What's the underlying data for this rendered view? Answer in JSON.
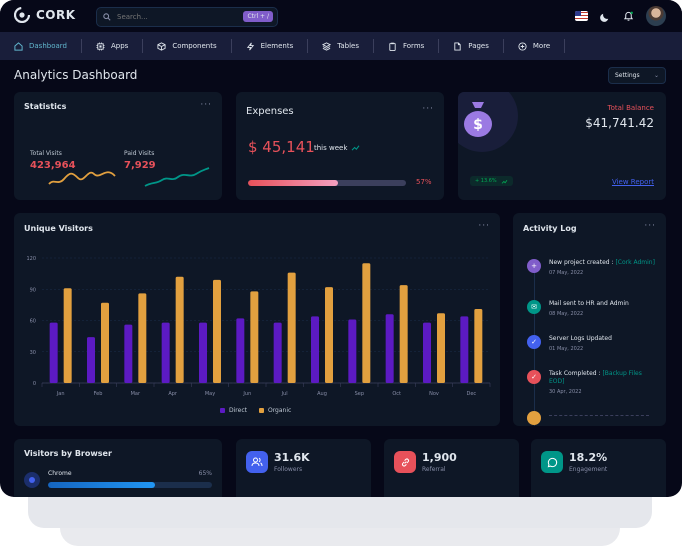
{
  "app": {
    "name": "CORK"
  },
  "search": {
    "placeholder": "Search...",
    "shortcut": "Ctrl + /"
  },
  "nav": {
    "items": [
      {
        "label": "Dashboard",
        "icon": "home-icon",
        "active": true
      },
      {
        "label": "Apps",
        "icon": "cpu-icon"
      },
      {
        "label": "Components",
        "icon": "box-icon"
      },
      {
        "label": "Elements",
        "icon": "zap-icon"
      },
      {
        "label": "Tables",
        "icon": "layers-icon"
      },
      {
        "label": "Forms",
        "icon": "clipboard-icon"
      },
      {
        "label": "Pages",
        "icon": "file-icon"
      },
      {
        "label": "More",
        "icon": "plus-circle-icon"
      }
    ]
  },
  "page": {
    "title": "Analytics Dashboard",
    "settings_label": "Settings"
  },
  "statistics": {
    "title": "Statistics",
    "total_visits_label": "Total Visits",
    "total_visits_value": "423,964",
    "paid_visits_label": "Paid Visits",
    "paid_visits_value": "7,929"
  },
  "expenses": {
    "title": "Expenses",
    "amount": "$ 45,141",
    "period": "this week",
    "progress": 57,
    "progress_label": "57%"
  },
  "balance": {
    "label": "Total Balance",
    "value": "$41,741.42",
    "change": "+ 13.6%",
    "link": "View Report"
  },
  "unique_visitors": {
    "title": "Unique Visitors"
  },
  "chart_data": {
    "type": "bar",
    "categories": [
      "Jan",
      "Feb",
      "Mar",
      "Apr",
      "May",
      "Jun",
      "Jul",
      "Aug",
      "Sep",
      "Oct",
      "Nov",
      "Dec"
    ],
    "series": [
      {
        "name": "Direct",
        "color": "#5c1ac3",
        "values": [
          58,
          44,
          56,
          58,
          58,
          62,
          58,
          64,
          61,
          66,
          58,
          64
        ]
      },
      {
        "name": "Organic",
        "color": "#e2a03f",
        "values": [
          91,
          77,
          86,
          102,
          99,
          88,
          106,
          92,
          115,
          94,
          67,
          71
        ]
      }
    ],
    "yticks": [
      "0",
      "30",
      "60",
      "90",
      "120"
    ],
    "ylim": [
      0,
      120
    ],
    "legend": "bottom",
    "grid": true
  },
  "activity": {
    "title": "Activity Log",
    "items": [
      {
        "title": "New project created :",
        "highlight": "[Cork Admin]",
        "date": "07 May, 2022",
        "color": "#805dca",
        "icon": "plus-icon"
      },
      {
        "title": "Mail sent to HR and Admin",
        "highlight": "",
        "date": "08 May, 2022",
        "color": "#009688",
        "icon": "mail-icon"
      },
      {
        "title": "Server Logs Updated",
        "highlight": "",
        "date": "01 May, 2022",
        "color": "#4361ee",
        "icon": "check-icon"
      },
      {
        "title": "Task Completed :",
        "highlight": "[Backup Files EOD]",
        "date": "30 Apr, 2022",
        "color": "#e7515a",
        "icon": "check-icon"
      }
    ]
  },
  "browser": {
    "title": "Visitors by Browser",
    "name": "Chrome",
    "percent_label": "65%",
    "percent": 65
  },
  "followers": {
    "value": "31.6K",
    "label": "Followers"
  },
  "referral": {
    "value": "1,900",
    "label": "Referral"
  },
  "engagement": {
    "value": "18.2%",
    "label": "Engagement"
  }
}
